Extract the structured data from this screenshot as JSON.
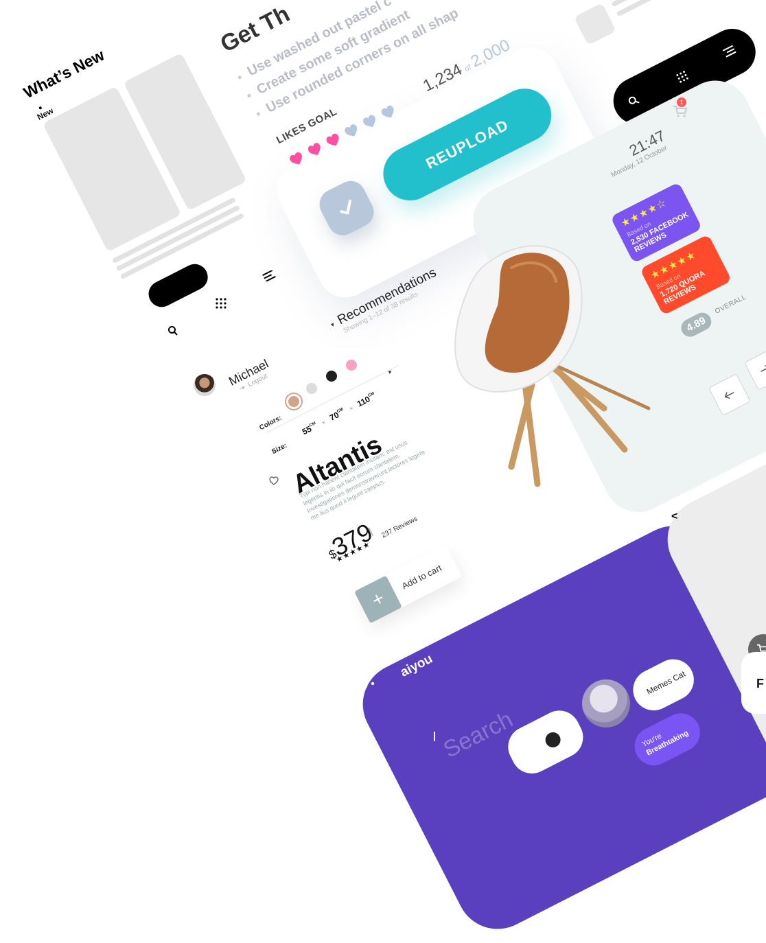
{
  "wireframe": {
    "title": "What’s New",
    "tag": "New"
  },
  "upload_card": {
    "heading": "Get Th",
    "tips": [
      "Use washed out pastel c",
      "Create some soft gradient",
      "Use rounded corners on all shap"
    ],
    "likes_label": "LIKES GOAL",
    "count": "1,234",
    "count_of": "of",
    "goal": "2,000",
    "reupload_label": "REUPLOAD",
    "hearts": {
      "filled": 3,
      "total": 6,
      "filled_color": "#ff4fa3",
      "empty_color": "#b6c6dc"
    }
  },
  "chair_panel": {
    "time": "21:47",
    "date": "Monday, 12 October",
    "cart_count": "1",
    "facebook": {
      "stars": "★★★★☆",
      "based_on": "Based on",
      "text": "2,530 FACEBOOK REVIEWS",
      "color": "#7c55f0"
    },
    "quora": {
      "stars": "★★★★★",
      "based_on": "Based on",
      "text": "1,720 QUORA REVIEWS",
      "color": "#ff4a2b"
    },
    "overall_score": "4.89",
    "overall_label": "OVERALL"
  },
  "product": {
    "recommendations": "Recommendations",
    "showing": "Showing 1–12 of 38 results",
    "user_name": "Michael",
    "logout": "Logout",
    "colors_label": "Colors:",
    "swatches": [
      "#d4a48a",
      "#dcdcdc",
      "#1f1f1f",
      "#f7a1c4"
    ],
    "size_label": "Size:",
    "sizes": [
      "55",
      "70",
      "110"
    ],
    "size_unit": "CM",
    "size_sep": "×",
    "name": "Altantis",
    "description": "Typi non habent claritatem insitam; est usus legentis in iis qui facit eorum claritatem. Investigationes demonstraverunt lectores legere me lius quod ii legunt saepius.",
    "currency": "$",
    "price": "379",
    "stars": "★★★★★",
    "reviews": "237 Reviews",
    "add_to_cart": "Add to cart"
  },
  "purple_app": {
    "brand": "aiyou",
    "search_placeholder": "Search",
    "bubble_memes": "Memes Cat",
    "bubble_breathtaking_1": "You're",
    "bubble_breathtaking_2": "Breathtaking"
  },
  "gray_panel": {
    "back_glyph": "<",
    "partial_letter": "F"
  }
}
